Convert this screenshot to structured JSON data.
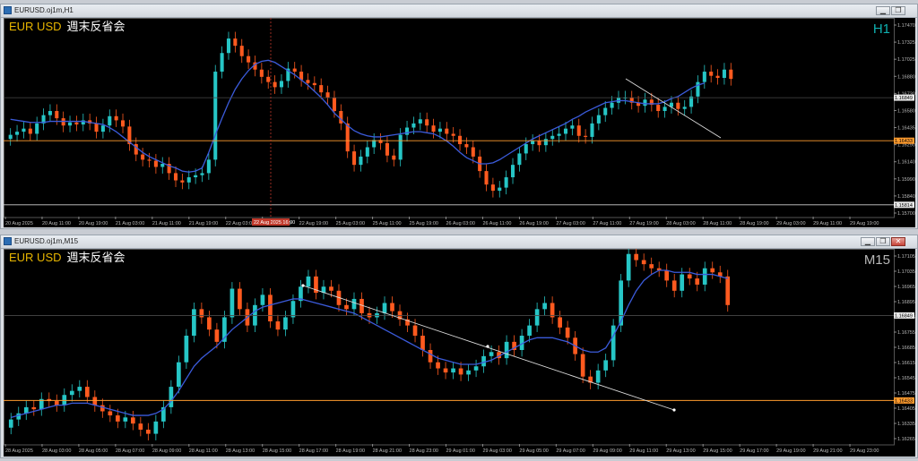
{
  "windows": [
    {
      "title": "EURUSD.oj1m,H1",
      "symbol": "EUR USD",
      "caption": "週末反省会",
      "timeframe": "H1",
      "price_ticks": [
        "1.17470",
        "1.17325",
        "1.17025",
        "1.16880",
        "1.16730",
        "1.16580",
        "1.16435",
        "1.16290",
        "1.16140",
        "1.15990",
        "1.15840",
        "1.15700"
      ],
      "current_price": "1.16849",
      "level_price": "1.16433",
      "low_price": "1.15814",
      "time_labels": [
        "20 Aug 2025",
        "20 Aug 11:00",
        "20 Aug 19:00",
        "21 Aug 03:00",
        "21 Aug 11:00",
        "21 Aug 19:00",
        "22 Aug 03:00",
        "22 Aug 11:00",
        "22 Aug 19:00",
        "25 Aug 03:00",
        "25 Aug 11:00",
        "25 Aug 19:00",
        "26 Aug 03:00",
        "26 Aug 11:00",
        "26 Aug 19:00",
        "27 Aug 03:00",
        "27 Aug 11:00",
        "27 Aug 19:00",
        "28 Aug 03:00",
        "28 Aug 11:00",
        "28 Aug 19:00",
        "29 Aug 03:00",
        "29 Aug 11:00",
        "29 Aug 19:00"
      ],
      "crosshair_time": "22 Aug 2025 16:00",
      "chart_data": {
        "type": "candlestick",
        "closes": [
          1.1649,
          1.1652,
          1.1655,
          1.165,
          1.166,
          1.1668,
          1.1672,
          1.1665,
          1.1658,
          1.1661,
          1.1659,
          1.1663,
          1.166,
          1.1652,
          1.1658,
          1.1667,
          1.1663,
          1.1657,
          1.164,
          1.163,
          1.1625,
          1.1624,
          1.1618,
          1.1621,
          1.1612,
          1.1605,
          1.1603,
          1.1608,
          1.161,
          1.1612,
          1.1625,
          1.171,
          1.1728,
          1.1742,
          1.1735,
          1.1725,
          1.1719,
          1.1712,
          1.1705,
          1.17,
          1.1695,
          1.1701,
          1.1713,
          1.171,
          1.1702,
          1.1699,
          1.1697,
          1.169,
          1.1685,
          1.1672,
          1.166,
          1.1633,
          1.162,
          1.1628,
          1.1637,
          1.1644,
          1.1641,
          1.1629,
          1.1625,
          1.1649,
          1.1656,
          1.166,
          1.1664,
          1.1658,
          1.1652,
          1.1655,
          1.165,
          1.1648,
          1.164,
          1.1637,
          1.1628,
          1.1614,
          1.1601,
          1.1595,
          1.1598,
          1.1608,
          1.162,
          1.1631,
          1.164,
          1.1643,
          1.1639,
          1.1645,
          1.1648,
          1.165,
          1.1655,
          1.1658,
          1.1648,
          1.1647,
          1.166,
          1.1668,
          1.1675,
          1.168,
          1.1685,
          1.1685,
          1.168,
          1.1677,
          1.1683,
          1.1678,
          1.1672,
          1.1676,
          1.168,
          1.1674,
          1.1676,
          1.1686,
          1.17,
          1.171,
          1.1706,
          1.1704,
          1.1712,
          1.1703
        ],
        "ma": [
          1.1664,
          1.1663,
          1.1662,
          1.1661,
          1.1661,
          1.1661,
          1.1662,
          1.1662,
          1.1662,
          1.1662,
          1.1662,
          1.1662,
          1.1661,
          1.166,
          1.1659,
          1.1656,
          1.1652,
          1.1647,
          1.1642,
          1.1637,
          1.1632,
          1.1628,
          1.1625,
          1.1622,
          1.1619,
          1.1617,
          1.1614,
          1.1613,
          1.1614,
          1.1617,
          1.1632,
          1.1649,
          1.1665,
          1.168,
          1.1693,
          1.1703,
          1.1711,
          1.1717,
          1.172,
          1.1721,
          1.1719,
          1.1715,
          1.1711,
          1.1707,
          1.1702,
          1.1697,
          1.1691,
          1.1685,
          1.1678,
          1.167,
          1.1664,
          1.1658,
          1.1653,
          1.165,
          1.1648,
          1.1647,
          1.1647,
          1.1648,
          1.1649,
          1.165,
          1.1651,
          1.1652,
          1.1652,
          1.1651,
          1.165,
          1.1647,
          1.1643,
          1.1638,
          1.1632,
          1.1627,
          1.1624,
          1.1621,
          1.1621,
          1.1622,
          1.1625,
          1.1629,
          1.1633,
          1.1637,
          1.1641,
          1.1645,
          1.1648,
          1.1651,
          1.1654,
          1.1657,
          1.166,
          1.1664,
          1.1667,
          1.1671,
          1.1674,
          1.1677,
          1.168,
          1.1681,
          1.1682,
          1.1682,
          1.1681,
          1.168,
          1.1679,
          1.1679,
          1.1679,
          1.1681,
          1.1684,
          1.1686,
          1.169,
          1.1694,
          1.1697,
          1.1699
        ],
        "ylim": [
          1.157,
          1.1755
        ]
      }
    },
    {
      "title": "EURUSD.oj1m,M15",
      "symbol": "EUR USD",
      "caption": "週末反省会",
      "timeframe": "M15",
      "price_ticks": [
        "1.17105",
        "1.17035",
        "1.16965",
        "1.16895",
        "1.16825",
        "1.16755",
        "1.16685",
        "1.16615",
        "1.16545",
        "1.16475",
        "1.16405",
        "1.16335",
        "1.16265"
      ],
      "current_price": "1.16849",
      "level_price": "1.16433",
      "time_labels": [
        "28 Aug 2025",
        "28 Aug 03:00",
        "28 Aug 05:00",
        "28 Aug 07:00",
        "28 Aug 09:00",
        "28 Aug 11:00",
        "28 Aug 13:00",
        "28 Aug 15:00",
        "28 Aug 17:00",
        "28 Aug 19:00",
        "28 Aug 21:00",
        "28 Aug 23:00",
        "29 Aug 01:00",
        "29 Aug 03:00",
        "29 Aug 05:00",
        "29 Aug 07:00",
        "29 Aug 09:00",
        "29 Aug 11:00",
        "29 Aug 13:00",
        "29 Aug 15:00",
        "29 Aug 17:00",
        "29 Aug 19:00",
        "29 Aug 21:00",
        "29 Aug 23:00"
      ],
      "chart_data": {
        "type": "candlestick",
        "closes": [
          1.1634,
          1.1637,
          1.164,
          1.1639,
          1.1644,
          1.1643,
          1.1641,
          1.1646,
          1.1648,
          1.165,
          1.1645,
          1.1641,
          1.1638,
          1.1636,
          1.1633,
          1.1635,
          1.1632,
          1.1629,
          1.1627,
          1.1633,
          1.164,
          1.165,
          1.1662,
          1.1675,
          1.1688,
          1.1684,
          1.1678,
          1.1672,
          1.1684,
          1.1698,
          1.1688,
          1.168,
          1.169,
          1.1695,
          1.1682,
          1.1678,
          1.1684,
          1.1692,
          1.1699,
          1.1704,
          1.1696,
          1.1699,
          1.1697,
          1.169,
          1.1688,
          1.1693,
          1.1686,
          1.1684,
          1.1686,
          1.1691,
          1.1687,
          1.1683,
          1.168,
          1.1675,
          1.1668,
          1.1662,
          1.1659,
          1.1657,
          1.1659,
          1.1656,
          1.1658,
          1.166,
          1.1665,
          1.1667,
          1.1664,
          1.1672,
          1.1668,
          1.1675,
          1.168,
          1.1688,
          1.1691,
          1.1684,
          1.1679,
          1.1674,
          1.1666,
          1.1655,
          1.1652,
          1.1658,
          1.1663,
          1.168,
          1.1702,
          1.1715,
          1.1712,
          1.171,
          1.1708,
          1.1707,
          1.1702,
          1.1697,
          1.1705,
          1.1703,
          1.17,
          1.1708,
          1.1706,
          1.1704,
          1.169
        ],
        "ma": [
          1.1635,
          1.1636,
          1.1637,
          1.1638,
          1.1639,
          1.164,
          1.1641,
          1.1641,
          1.1642,
          1.1642,
          1.1642,
          1.1641,
          1.164,
          1.1639,
          1.1638,
          1.1637,
          1.1636,
          1.1636,
          1.1636,
          1.1637,
          1.1639,
          1.1643,
          1.1648,
          1.1654,
          1.166,
          1.1664,
          1.1667,
          1.167,
          1.1674,
          1.1678,
          1.1681,
          1.1684,
          1.1687,
          1.1689,
          1.169,
          1.1691,
          1.1692,
          1.1693,
          1.1693,
          1.1692,
          1.1691,
          1.169,
          1.1689,
          1.1688,
          1.1687,
          1.1686,
          1.1684,
          1.1682,
          1.168,
          1.1678,
          1.1676,
          1.1674,
          1.1672,
          1.167,
          1.1668,
          1.1666,
          1.1664,
          1.1663,
          1.1662,
          1.1661,
          1.1661,
          1.1661,
          1.1662,
          1.1663,
          1.1665,
          1.1667,
          1.1669,
          1.1671,
          1.1673,
          1.1674,
          1.1674,
          1.1674,
          1.1673,
          1.1672,
          1.167,
          1.1668,
          1.1667,
          1.1667,
          1.1669,
          1.1675,
          1.1682,
          1.169,
          1.1697,
          1.1702,
          1.1705,
          1.1707,
          1.1707,
          1.1706,
          1.1706,
          1.1706,
          1.1705,
          1.1705,
          1.1705,
          1.1704,
          1.1703
        ],
        "ylim": [
          1.1622,
          1.1714
        ]
      }
    }
  ],
  "colors": {
    "bull": "#26c6c6",
    "bear": "#ff5a1f",
    "ma": "#3b5bdb",
    "level": "#ff9b2e",
    "trend": "#dddddd",
    "h1_label": "#0fb0b0",
    "m15_label": "#b8b8b8"
  }
}
